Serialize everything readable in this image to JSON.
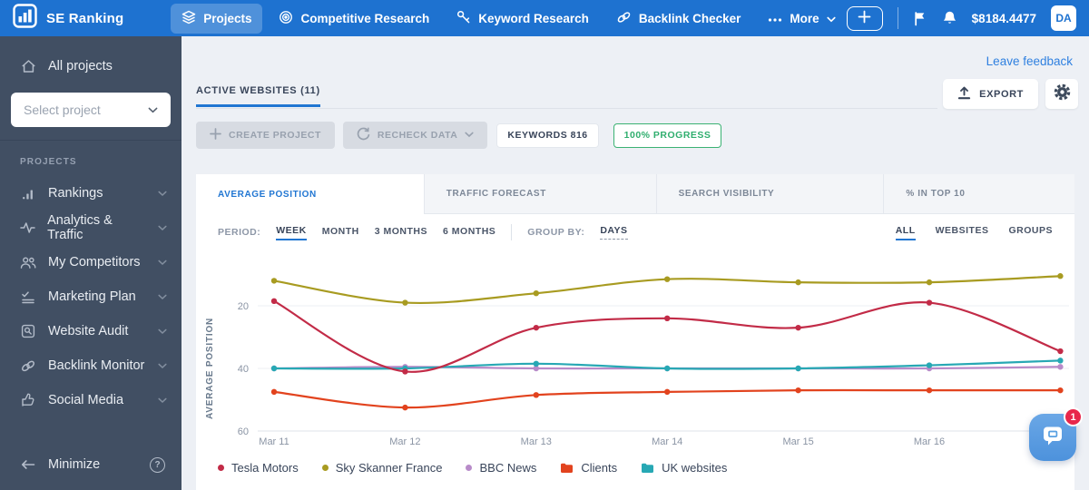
{
  "topbar": {
    "brand": "SE Ranking",
    "nav": [
      {
        "label": "Projects",
        "active": true
      },
      {
        "label": "Competitive Research",
        "active": false
      },
      {
        "label": "Keyword Research",
        "active": false
      },
      {
        "label": "Backlink Checker",
        "active": false
      },
      {
        "label": "More",
        "active": false
      }
    ],
    "balance": "$8184.4477",
    "avatar": "DA"
  },
  "sidebar": {
    "all_projects": "All projects",
    "select_project_placeholder": "Select project",
    "section_label": "PROJECTS",
    "items": [
      {
        "label": "Rankings"
      },
      {
        "label": "Analytics & Traffic"
      },
      {
        "label": "My Competitors"
      },
      {
        "label": "Marketing Plan"
      },
      {
        "label": "Website Audit"
      },
      {
        "label": "Backlink Monitor"
      },
      {
        "label": "Social Media"
      }
    ],
    "minimize": "Minimize"
  },
  "main": {
    "leave_feedback": "Leave feedback",
    "page_tab": "ACTIVE WEBSITES (11)",
    "export_label": "EXPORT",
    "create_project_label": "CREATE PROJECT",
    "recheck_data_label": "RECHECK DATA",
    "keywords_badge": "KEYWORDS 816",
    "progress_badge": "100% PROGRESS",
    "chart_tabs": [
      {
        "label": "AVERAGE POSITION",
        "active": true
      },
      {
        "label": "TRAFFIC FORECAST",
        "active": false
      },
      {
        "label": "SEARCH VISIBILITY",
        "active": false
      },
      {
        "label": "% IN TOP 10",
        "active": false
      }
    ],
    "period_label": "PERIOD:",
    "periods": [
      {
        "label": "WEEK",
        "active": true
      },
      {
        "label": "MONTH",
        "active": false
      },
      {
        "label": "3 MONTHS",
        "active": false
      },
      {
        "label": "6 MONTHS",
        "active": false
      }
    ],
    "group_by_label": "GROUP BY:",
    "group_by_value": "DAYS",
    "scope_tabs": [
      {
        "label": "ALL",
        "active": true
      },
      {
        "label": "WEBSITES",
        "active": false
      },
      {
        "label": "GROUPS",
        "active": false
      }
    ],
    "chat_badge": "1"
  },
  "chart_data": {
    "type": "line",
    "title": "",
    "xlabel": "",
    "ylabel": "AVERAGE POSITION",
    "x_labels": [
      "Mar 11",
      "Mar 12",
      "Mar 13",
      "Mar 14",
      "Mar 15",
      "Mar 16",
      ""
    ],
    "y_ticks": [
      20,
      40,
      60
    ],
    "y_inverted": true,
    "ylim": [
      6,
      62
    ],
    "grid": true,
    "legend_position": "bottom",
    "series": [
      {
        "name": "Tesla Motors",
        "color": "#c22b47",
        "legend_icon": "dot",
        "values": [
          18.5,
          41,
          27,
          24,
          27,
          19,
          34.5
        ]
      },
      {
        "name": "Sky Skanner France",
        "color": "#a89b21",
        "legend_icon": "dot",
        "values": [
          12,
          19,
          16,
          11.5,
          12.5,
          12.5,
          10.5
        ]
      },
      {
        "name": "BBC News",
        "color": "#b88bc9",
        "legend_icon": "dot",
        "values": [
          40,
          39.5,
          40,
          40,
          40,
          40,
          39.5
        ]
      },
      {
        "name": "Clients",
        "color": "#e2431e",
        "legend_icon": "folder",
        "values": [
          47.5,
          52.5,
          48.5,
          47.5,
          47,
          47,
          47
        ]
      },
      {
        "name": "UK websites",
        "color": "#27a8b4",
        "legend_icon": "folder",
        "values": [
          40,
          40,
          38.5,
          40,
          40,
          39,
          37.5
        ]
      }
    ]
  }
}
